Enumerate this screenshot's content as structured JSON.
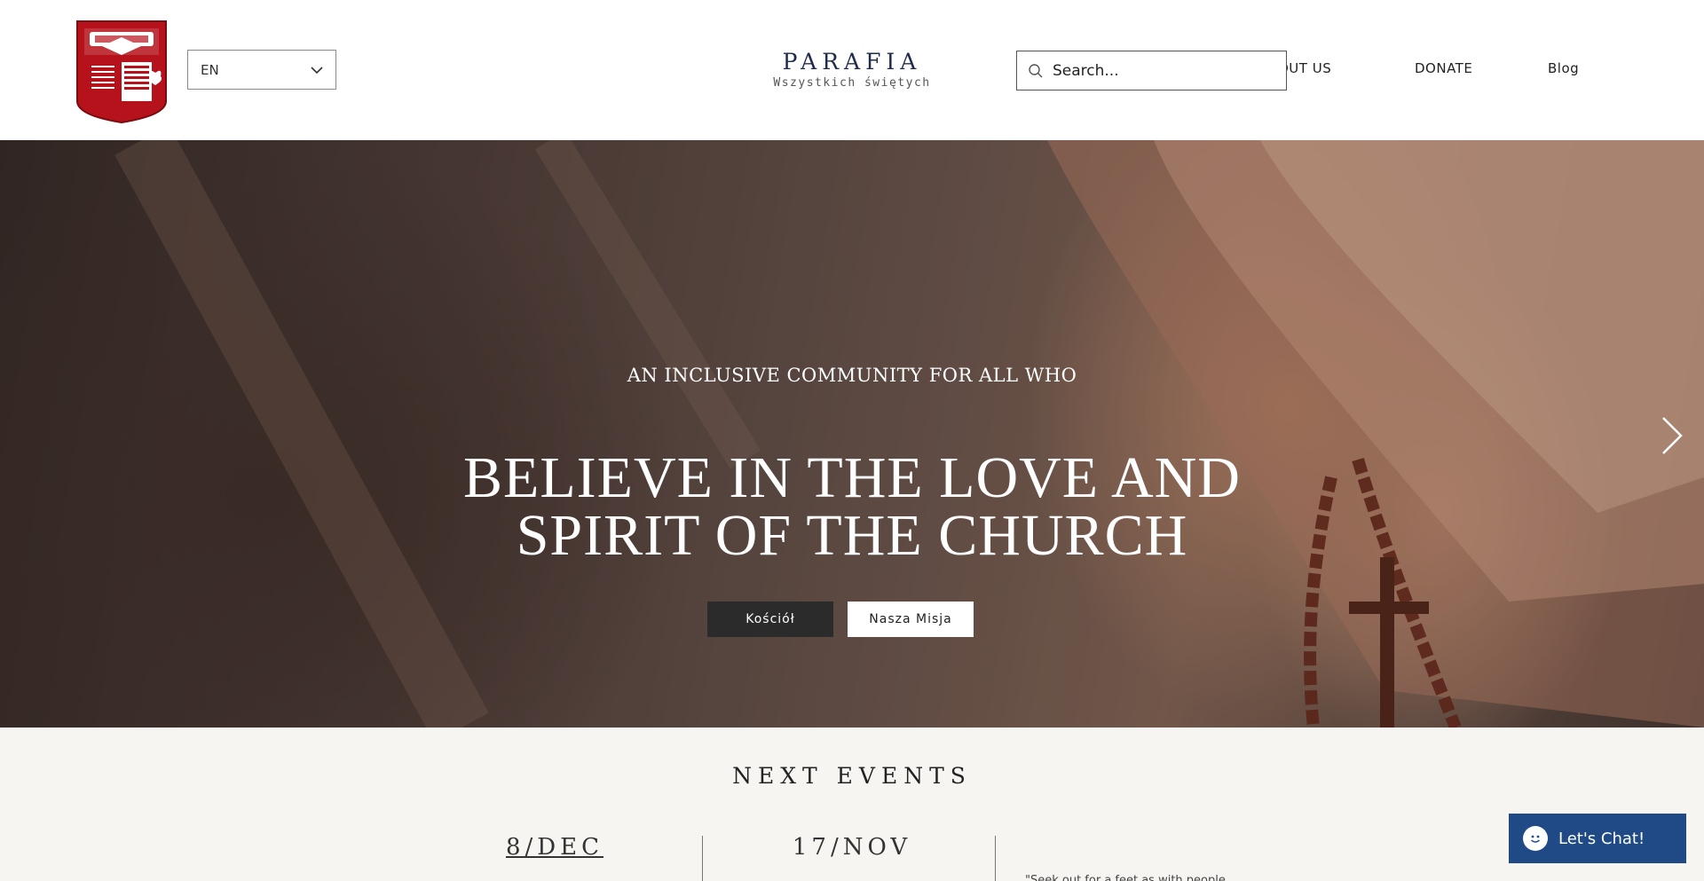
{
  "header": {
    "logo_alt": "Parafia logo",
    "language": {
      "selected": "EN"
    },
    "brand": {
      "title": "PARAFIA",
      "subtitle": "Wszystkich świętych"
    },
    "search": {
      "placeholder": "Search..."
    },
    "nav": [
      {
        "label": "OUT US"
      },
      {
        "label": "DONATE"
      },
      {
        "label": "Blog"
      }
    ]
  },
  "hero": {
    "kicker": "AN INCLUSIVE COMMUNITY FOR ALL WHO",
    "title_line1": "BELIEVE IN THE LOVE AND",
    "title_line2": "SPIRIT OF THE CHURCH",
    "buttons": [
      {
        "label": "Kościół"
      },
      {
        "label": "Nasza Misja"
      }
    ]
  },
  "events": {
    "title": "NEXT EVENTS",
    "dates": [
      "8/DEC",
      "17/NOV"
    ],
    "quote_snippet": "\"Seek out for a feet as with people..."
  },
  "chat": {
    "label": "Let's Chat!"
  },
  "colors": {
    "brand_navy": "#1e2b4a",
    "chat_blue": "#1f4a86",
    "logo_red": "#b5121b",
    "events_bg": "#f6f5f2"
  }
}
